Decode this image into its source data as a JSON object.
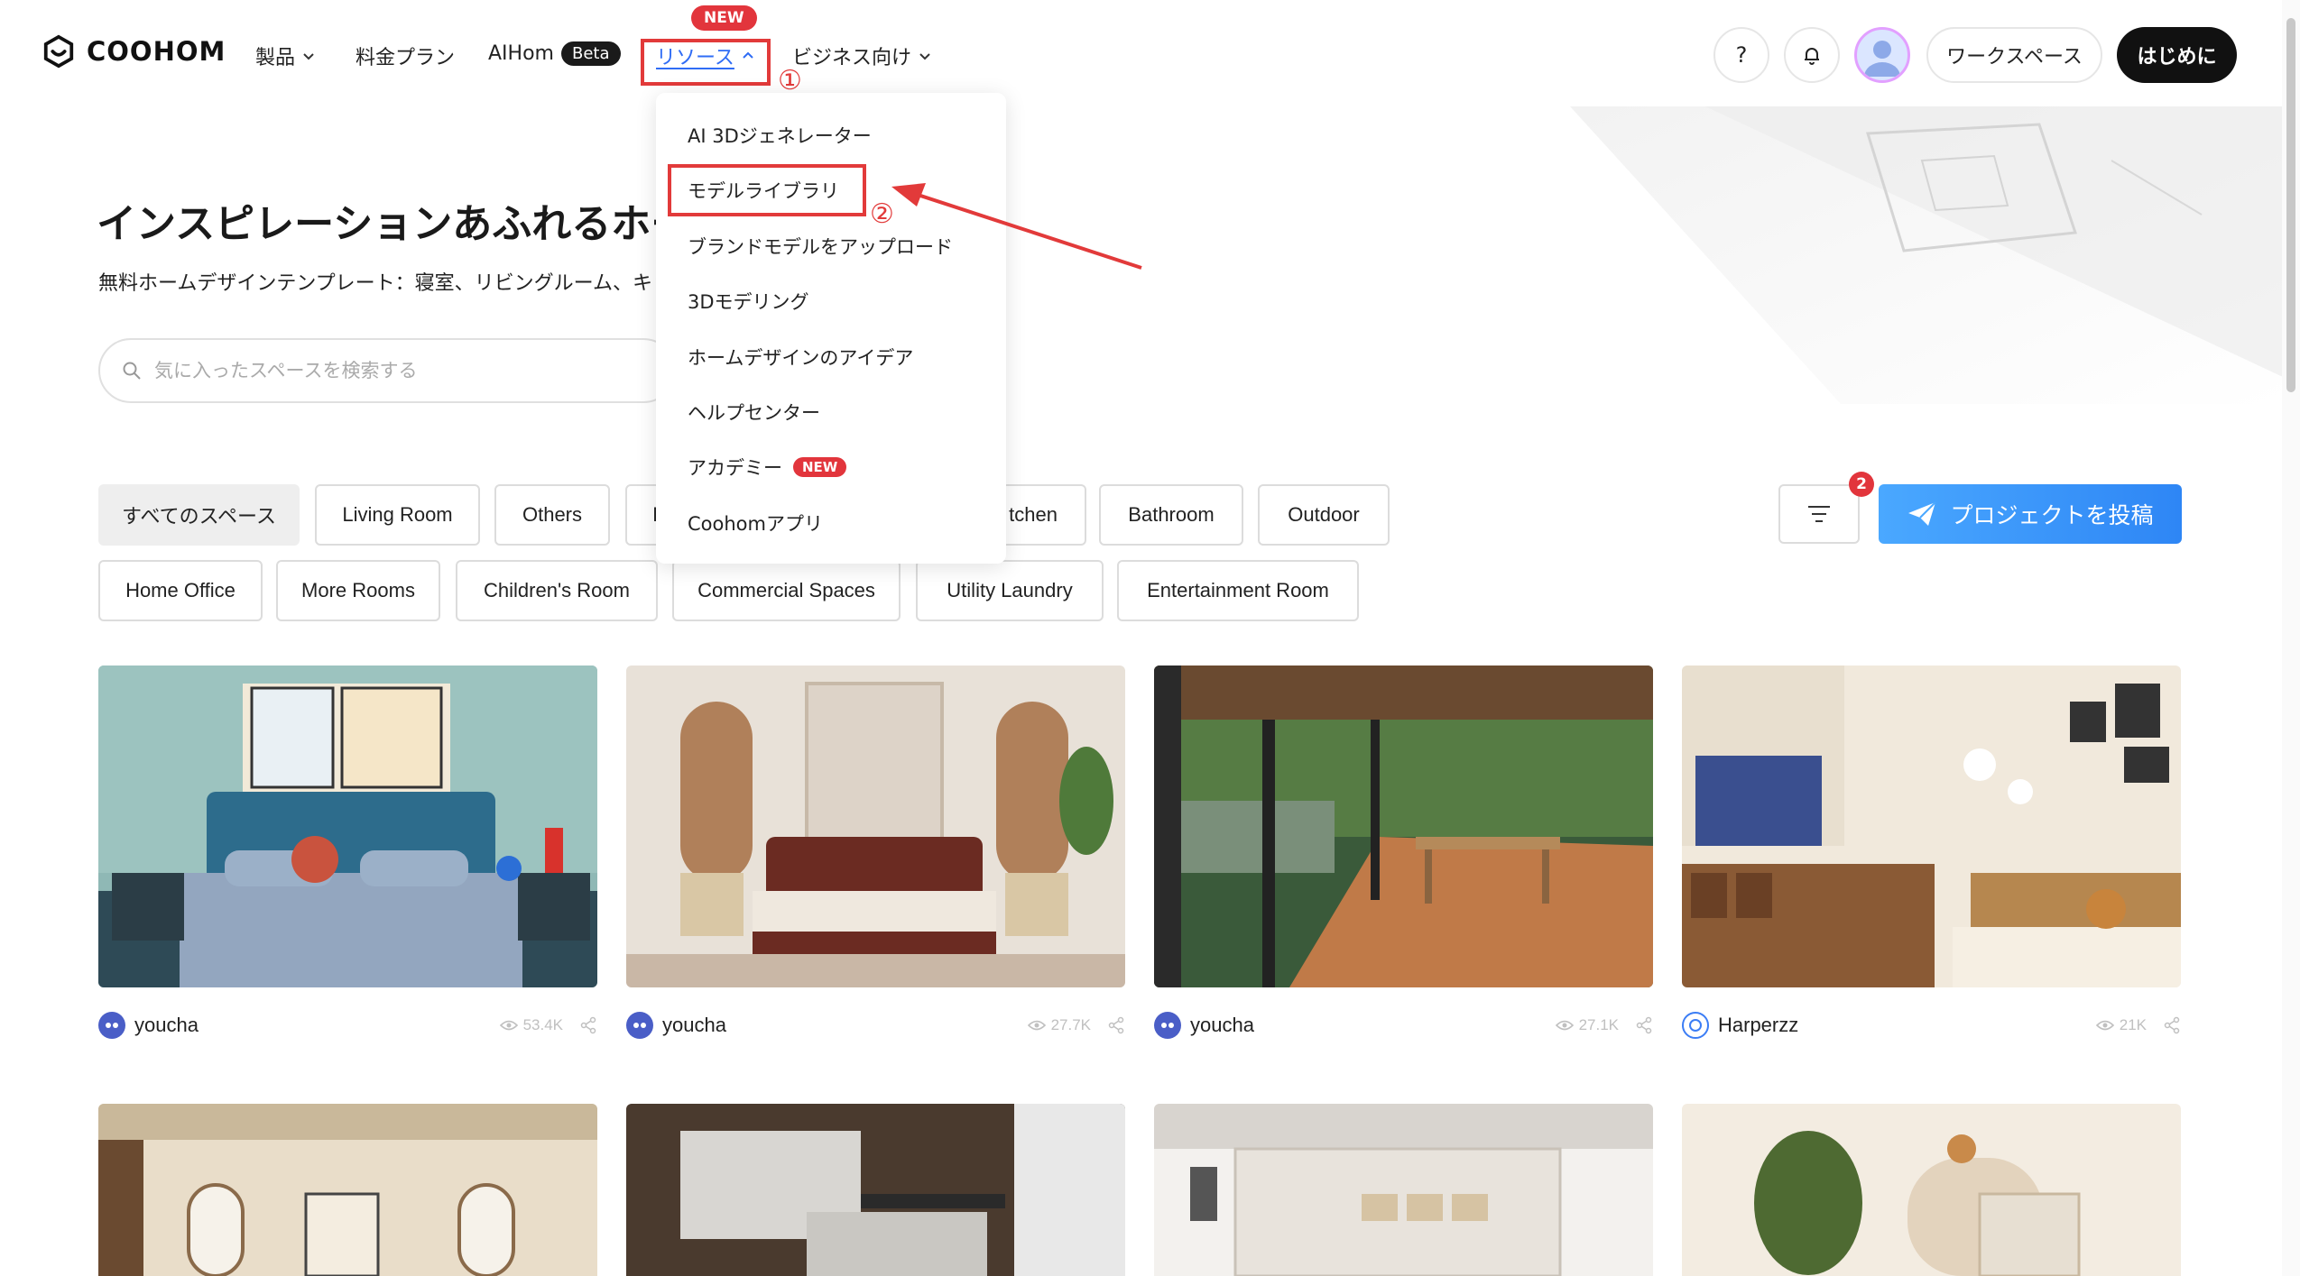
{
  "header": {
    "brand": "COOHOM",
    "nav": {
      "products": "製品",
      "pricing": "料金プラン",
      "aihom": "AIHom",
      "aihom_badge": "Beta",
      "resources": "リソース",
      "resources_badge": "NEW",
      "business": "ビジネス向け"
    },
    "help": "?",
    "workspace": "ワークスペース",
    "start": "はじめに"
  },
  "annotations": {
    "step1": "①",
    "step2": "②"
  },
  "hero": {
    "title": "インスピレーションあふれるホームデザイン",
    "subtitle": "無料ホームデザインテンプレート：寝室、リビングルーム、キッチン",
    "search_placeholder": "気に入ったスペースを検索する"
  },
  "dropdown": {
    "items": [
      {
        "label": "AI 3Dジェネレーター"
      },
      {
        "label": "モデルライブラリ"
      },
      {
        "label": "ブランドモデルをアップロード"
      },
      {
        "label": "3Dモデリング"
      },
      {
        "label": "ホームデザインのアイデア"
      },
      {
        "label": "ヘルプセンター"
      },
      {
        "label": "アカデミー",
        "badge": "NEW"
      },
      {
        "label": "Coohomアプリ"
      }
    ]
  },
  "filters": {
    "row1": [
      "すべてのスペース",
      "Living Room",
      "Others",
      "I",
      "tchen",
      "Bathroom",
      "Outdoor"
    ],
    "row2": [
      "Home Office",
      "More Rooms",
      "Children's Room",
      "Commercial Spaces",
      "Utility Laundry",
      "Entertainment Room"
    ],
    "filter_badge": "2",
    "post_button": "プロジェクトを投稿"
  },
  "cards": [
    {
      "author": "youcha",
      "views": "53.4K"
    },
    {
      "author": "youcha",
      "views": "27.7K"
    },
    {
      "author": "youcha",
      "views": "27.1K"
    },
    {
      "author": "Harperzz",
      "views": "21K"
    }
  ],
  "colors": {
    "accent_red": "#e2353c",
    "link_blue": "#2f6cf5",
    "post_blue": "#2e86f5"
  }
}
